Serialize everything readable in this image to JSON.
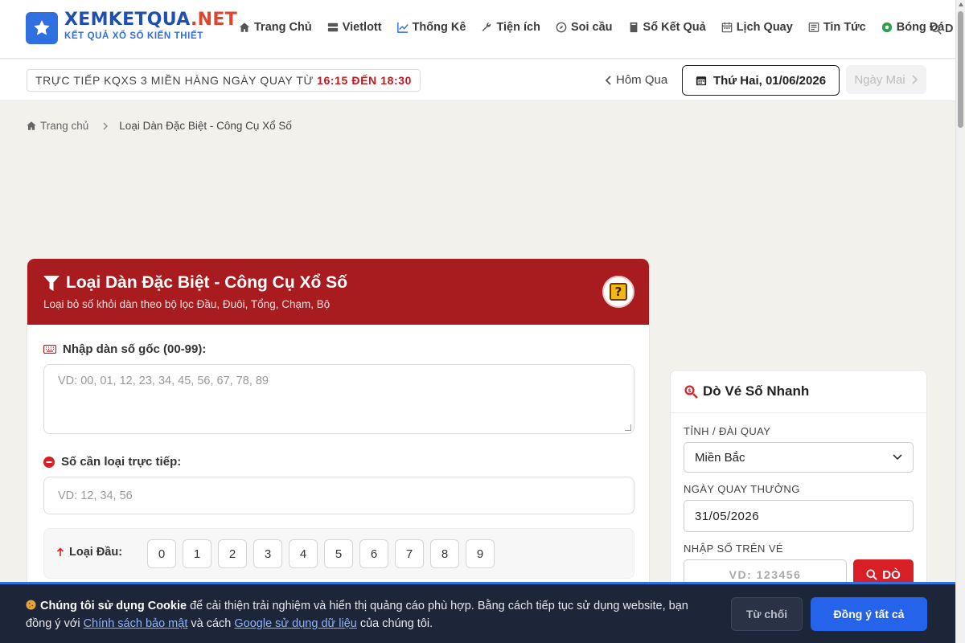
{
  "header": {
    "logo_main_a": "XEMKETQUA",
    "logo_main_b": ".NET",
    "logo_sub": "KẾT QUẢ XỔ SỐ KIẾN THIẾT",
    "nav": [
      {
        "label": "Trang Chủ",
        "icon": "home-icon"
      },
      {
        "label": "Vietlott",
        "icon": "server-icon"
      },
      {
        "label": "Thống Kê",
        "icon": "chart-line-icon"
      },
      {
        "label": "Tiện ích",
        "icon": "wrench-icon"
      },
      {
        "label": "Soi cầu",
        "icon": "compass-icon"
      },
      {
        "label": "Sổ Kết Quả",
        "icon": "book-icon"
      },
      {
        "label": "Lịch Quay",
        "icon": "calendar-icon"
      },
      {
        "label": "Tin Tức",
        "icon": "newspaper-icon"
      },
      {
        "label": "Bóng Đá",
        "icon": "soccer-ball-icon"
      }
    ],
    "search_label": "D"
  },
  "subbar": {
    "live_text": "TRỰC TIẾP KQXS 3 MIỀN HÀNG NGÀY QUAY TỪ",
    "live_time": "16:15 ĐẾN 18:30",
    "prev_label": "Hôm Qua",
    "current_date": "Thứ Hai, 01/06/2026",
    "next_label": "Ngày Mai"
  },
  "breadcrumb": {
    "home": "Trang chủ",
    "current": "Loại Dàn Đặc Biệt - Công Cụ Xổ Số"
  },
  "tool": {
    "title": "Loại Dàn Đặc Biệt - Công Cụ Xổ Số",
    "subtitle": "Loại bỏ số khỏi dàn theo bộ lọc Đầu, Đuôi, Tổng, Chạm, Bộ",
    "help_glyph": "?",
    "source_label": "Nhập dàn số gốc (00-99):",
    "source_placeholder": "VD: 00, 01, 12, 23, 34, 45, 56, 67, 78, 89",
    "remove_label": "Số cần loại trực tiếp:",
    "remove_placeholder": "VD: 12, 34, 56",
    "head_filter_label": "Loại Đầu:",
    "digits": [
      "0",
      "1",
      "2",
      "3",
      "4",
      "5",
      "6",
      "7",
      "8",
      "9"
    ]
  },
  "ticket": {
    "title": "Dò Vé Số Nhanh",
    "province_label": "TỈNH / ĐÀI QUAY",
    "province_value": "Miền Bắc",
    "date_label": "NGÀY QUAY THƯỞNG",
    "date_value": "31/05/2026",
    "number_label": "NHẬP SỐ TRÊN VÉ",
    "number_placeholder": "VD: 123456",
    "check_label": "DÒ"
  },
  "cookie": {
    "bold": "Chúng tôi sử dụng Cookie",
    "text1": " để cải thiện trải nghiệm và hiển thị quảng cáo phù hợp. Bằng cách tiếp tục sử dụng website, bạn đồng ý với ",
    "link1": "Chính sách bảo mật",
    "text2": " và cách ",
    "link2": "Google sử dụng dữ liệu",
    "text3": " của chúng tôi.",
    "reject": "Từ chối",
    "accept": "Đồng ý tất cả"
  },
  "colors": {
    "brand_blue": "#2f6fe0",
    "brand_red": "#a81c1f",
    "accent_red": "#d91f26",
    "cookie_bg": "#1d2538",
    "accept_blue": "#2563eb"
  }
}
